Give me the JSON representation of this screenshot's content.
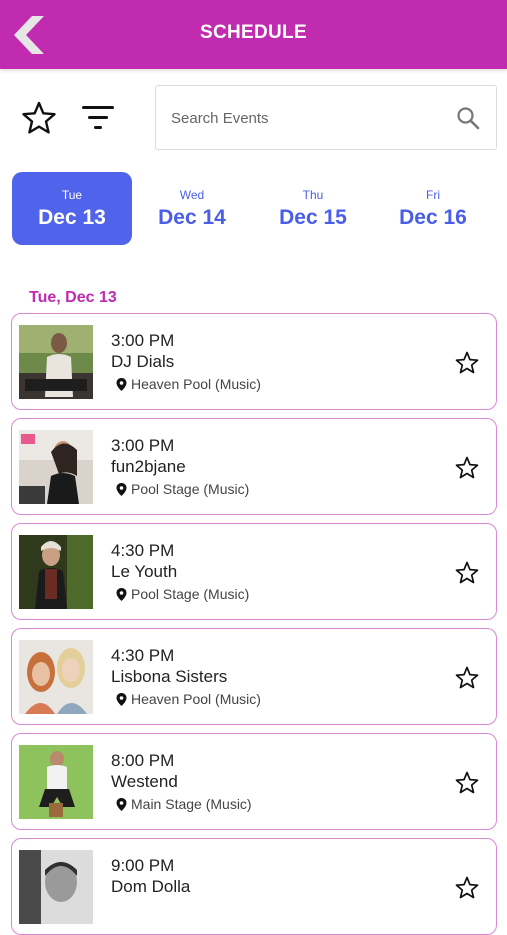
{
  "header": {
    "title": "SCHEDULE",
    "back_icon": "chevron-left-icon"
  },
  "toolbar": {
    "favorites_icon": "star-outline-icon",
    "filter_icon": "filter-icon"
  },
  "search": {
    "placeholder": "Search Events",
    "value": "",
    "icon": "search-icon"
  },
  "date_tabs": [
    {
      "dow": "Tue",
      "date": "Dec 13",
      "selected": true
    },
    {
      "dow": "Wed",
      "date": "Dec 14",
      "selected": false
    },
    {
      "dow": "Thu",
      "date": "Dec 15",
      "selected": false
    },
    {
      "dow": "Fri",
      "date": "Dec 16",
      "selected": false
    }
  ],
  "section": {
    "heading": "Tue, Dec 13"
  },
  "events": [
    {
      "time": "3:00 PM",
      "name": "DJ Dials",
      "venue": "Heaven Pool (Music)"
    },
    {
      "time": "3:00 PM",
      "name": "fun2bjane",
      "venue": "Pool Stage (Music)"
    },
    {
      "time": "4:30 PM",
      "name": "Le Youth",
      "venue": "Pool Stage (Music)"
    },
    {
      "time": "4:30 PM",
      "name": "Lisbona Sisters",
      "venue": "Heaven Pool (Music)"
    },
    {
      "time": "8:00 PM",
      "name": "Westend",
      "venue": "Main Stage (Music)"
    },
    {
      "time": "9:00 PM",
      "name": "Dom Dolla",
      "venue": ""
    }
  ],
  "colors": {
    "header": "#c02bb0",
    "accent_blue": "#4f64ea",
    "card_border": "#d98ad4",
    "section_heading": "#c02bb0"
  }
}
